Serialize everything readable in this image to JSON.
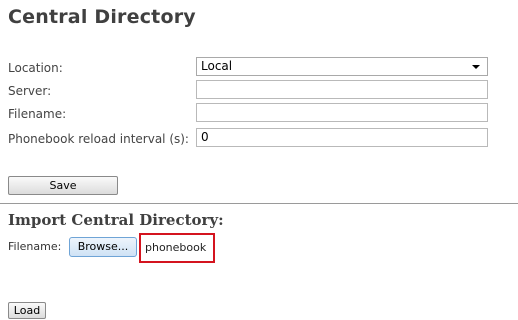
{
  "page": {
    "title": "Central Directory"
  },
  "form": {
    "location": {
      "label": "Location:",
      "value": "Local"
    },
    "server": {
      "label": "Server:",
      "value": ""
    },
    "filename": {
      "label": "Filename:",
      "value": ""
    },
    "reload_interval": {
      "label": "Phonebook reload interval (s):",
      "value": "0"
    },
    "save_label": "Save"
  },
  "import": {
    "title": "Import Central Directory:",
    "filename_label": "Filename:",
    "browse_label": "Browse...",
    "selected_file": "phonebook",
    "load_label": "Load",
    "highlight_color": "#d4141f"
  }
}
